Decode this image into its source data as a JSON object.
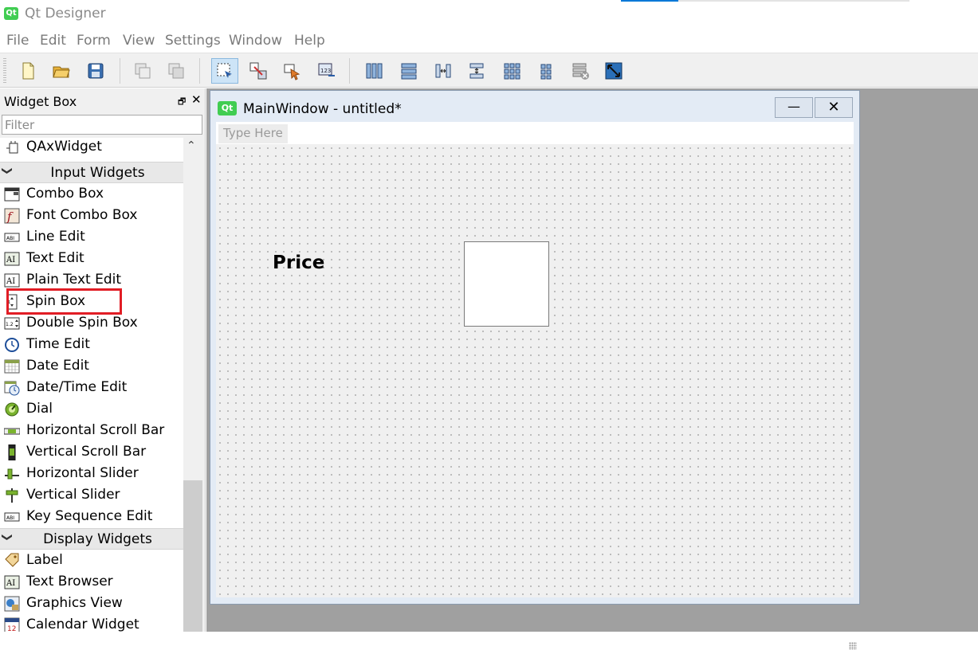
{
  "app": {
    "title": "Qt Designer",
    "badge": "Qt"
  },
  "menu": [
    "File",
    "Edit",
    "Form",
    "View",
    "Settings",
    "Window",
    "Help"
  ],
  "toolbar": {
    "buttons": [
      "new-form-icon",
      "open-form-icon",
      "save-form-icon",
      "copy-icon",
      "paste-icon",
      "edit-widgets-icon",
      "edit-signals-slots-icon",
      "edit-buddies-icon",
      "edit-tab-order-icon",
      "layout-horizontal-icon",
      "layout-vertical-icon",
      "layout-horizontal-splitter-icon",
      "layout-vertical-splitter-icon",
      "layout-grid-icon",
      "layout-form-icon",
      "break-layout-icon",
      "adjust-size-icon"
    ]
  },
  "widget_box": {
    "title": "Widget Box",
    "float_glyph": "🗗",
    "close_glyph": "✕",
    "filter_placeholder": "Filter",
    "items_top": [
      {
        "label": "QAxWidget",
        "icon": "qaxwidget-icon"
      }
    ],
    "categories": [
      {
        "label": "Input Widgets",
        "items": [
          {
            "label": "Combo Box",
            "icon": "combo-box-icon"
          },
          {
            "label": "Font Combo Box",
            "icon": "font-combo-box-icon"
          },
          {
            "label": "Line Edit",
            "icon": "line-edit-icon"
          },
          {
            "label": "Text Edit",
            "icon": "text-edit-icon"
          },
          {
            "label": "Plain Text Edit",
            "icon": "plain-text-edit-icon"
          },
          {
            "label": "Spin Box",
            "icon": "spin-box-icon"
          },
          {
            "label": "Double Spin Box",
            "icon": "double-spin-box-icon"
          },
          {
            "label": "Time Edit",
            "icon": "time-edit-icon"
          },
          {
            "label": "Date Edit",
            "icon": "date-edit-icon"
          },
          {
            "label": "Date/Time Edit",
            "icon": "date-time-edit-icon"
          },
          {
            "label": "Dial",
            "icon": "dial-icon"
          },
          {
            "label": "Horizontal Scroll Bar",
            "icon": "horizontal-scroll-bar-icon"
          },
          {
            "label": "Vertical Scroll Bar",
            "icon": "vertical-scroll-bar-icon"
          },
          {
            "label": "Horizontal Slider",
            "icon": "horizontal-slider-icon"
          },
          {
            "label": "Vertical Slider",
            "icon": "vertical-slider-icon"
          },
          {
            "label": "Key Sequence Edit",
            "icon": "key-sequence-edit-icon"
          }
        ]
      },
      {
        "label": "Display Widgets",
        "items": [
          {
            "label": "Label",
            "icon": "label-icon"
          },
          {
            "label": "Text Browser",
            "icon": "text-browser-icon"
          },
          {
            "label": "Graphics View",
            "icon": "graphics-view-icon"
          },
          {
            "label": "Calendar Widget",
            "icon": "calendar-widget-icon"
          }
        ]
      }
    ]
  },
  "form_window": {
    "badge": "Qt",
    "title": "MainWindow - untitled*",
    "minimize_glyph": "—",
    "close_glyph": "✕",
    "menubar_placeholder": "Type Here",
    "label_text": "Price"
  },
  "colors": {
    "qt_green": "#41cd52",
    "highlight_red": "#e11d25",
    "accent_blue": "#0078d7"
  }
}
